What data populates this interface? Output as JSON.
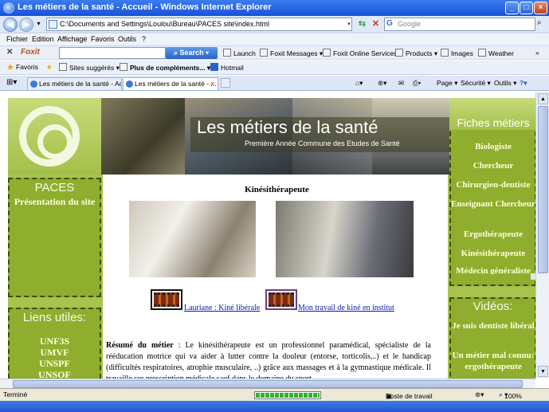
{
  "window": {
    "title": "Les métiers de la santé - Accueil - Windows Internet Explorer"
  },
  "address": {
    "url": "C:\\Documents and Settings\\Loulou\\Bureau\\PACES site\\index.html",
    "search_placeholder": "Google"
  },
  "menu": [
    "Fichier",
    "Edition",
    "Affichage",
    "Favoris",
    "Outils",
    "?"
  ],
  "foxit_toolbar": {
    "brand": "Foxit",
    "search_label": "Search",
    "items": [
      "Launch",
      "Foxit Messages",
      "Foxit Online Services",
      "Products",
      "Images",
      "Weather"
    ]
  },
  "favorites_bar": {
    "favorites": "Favoris",
    "items": [
      "Sites suggérés",
      "Plus de compléments...",
      "Hotmail"
    ]
  },
  "tabs": [
    {
      "label": "Les métiers de la santé - Acc..."
    },
    {
      "label": "Les métiers de la santé - ..."
    }
  ],
  "command_bar": {
    "page": "Page",
    "securite": "Sécurité",
    "outils": "Outils"
  },
  "site": {
    "banner_title": "Les métiers de la santé",
    "banner_subtitle": "Première Année Commune des Etudes de Santé",
    "paces_title": "PACES",
    "paces_link": "Présentation du site",
    "liens_title": "Liens utiles:",
    "liens": [
      "UNF3S",
      "UMVF",
      "UNSPF",
      "UNSOF"
    ],
    "heading": "Kinésithérapeute",
    "video_links": [
      "Lauriane : Kiné libérale",
      "Mon travail de kiné en institut"
    ],
    "resume_label": "Résumé du métier",
    "resume_text": " : Le kinésithérapeute est un professionnel paramédical, spécialiste de la rééducation motrice qui va aider à lutter contre la douleur (entorse, torticolis,..) et le handicap (difficultés respiratoires, atrophie musculaire, ..) grâce aux massages et à la gymnastique médicale. Il travaille sur prescription médicale sauf dans le domaine du sport.",
    "fiches_title": "Fiches métiers",
    "fiches": [
      "Biologiste",
      "Chercheur",
      "Chirurgien-dentiste",
      "Enseignant Chercheur",
      "Ergothérapeute",
      "Kinésithérapeute",
      "Médecin généraliste"
    ],
    "videos_title": "Vidéos:",
    "videos": [
      "Je suis dentiste libéral",
      "Un métier mal connu: ergothérapeute"
    ]
  },
  "status": {
    "left": "Terminé",
    "zone": "Poste de travail",
    "zoom": "100%",
    "progress": 1.0
  }
}
